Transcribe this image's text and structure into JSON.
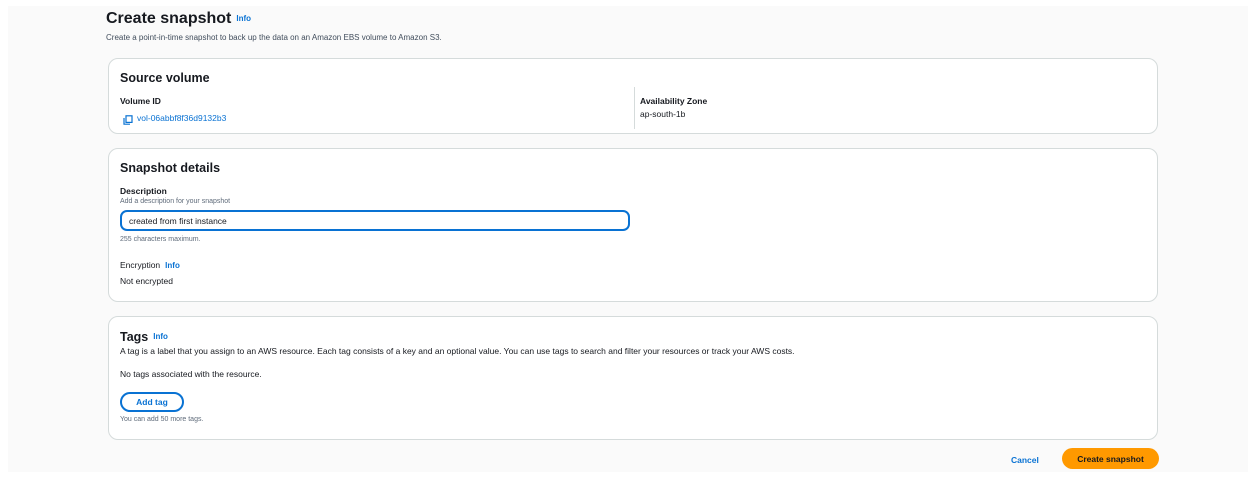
{
  "page": {
    "title": "Create snapshot",
    "info_label": "Info",
    "description": "Create a point-in-time snapshot to back up the data on an Amazon EBS volume to Amazon S3."
  },
  "source_volume": {
    "title": "Source volume",
    "volume_id_label": "Volume ID",
    "volume_id_value": "vol-06abbf8f36d9132b3",
    "copy_icon": "copy-icon",
    "az_label": "Availability Zone",
    "az_value": "ap-south-1b"
  },
  "snapshot_details": {
    "title": "Snapshot details",
    "description_label": "Description",
    "description_hint": "Add a description for your snapshot",
    "description_value": "created from first instance",
    "description_constraint": "255 characters maximum.",
    "encryption_label": "Encryption",
    "encryption_info": "Info",
    "encryption_value": "Not encrypted"
  },
  "tags": {
    "title": "Tags",
    "info_label": "Info",
    "description": "A tag is a label that you assign to an AWS resource. Each tag consists of a key and an optional value. You can use tags to search and filter your resources or track your AWS costs.",
    "empty_text": "No tags associated with the resource.",
    "add_button": "Add tag",
    "limit_text": "You can add 50 more tags."
  },
  "footer": {
    "cancel_label": "Cancel",
    "submit_label": "Create snapshot"
  },
  "colors": {
    "link": "#0972d3",
    "primary": "#ff9900",
    "border": "#d5dbdb"
  }
}
